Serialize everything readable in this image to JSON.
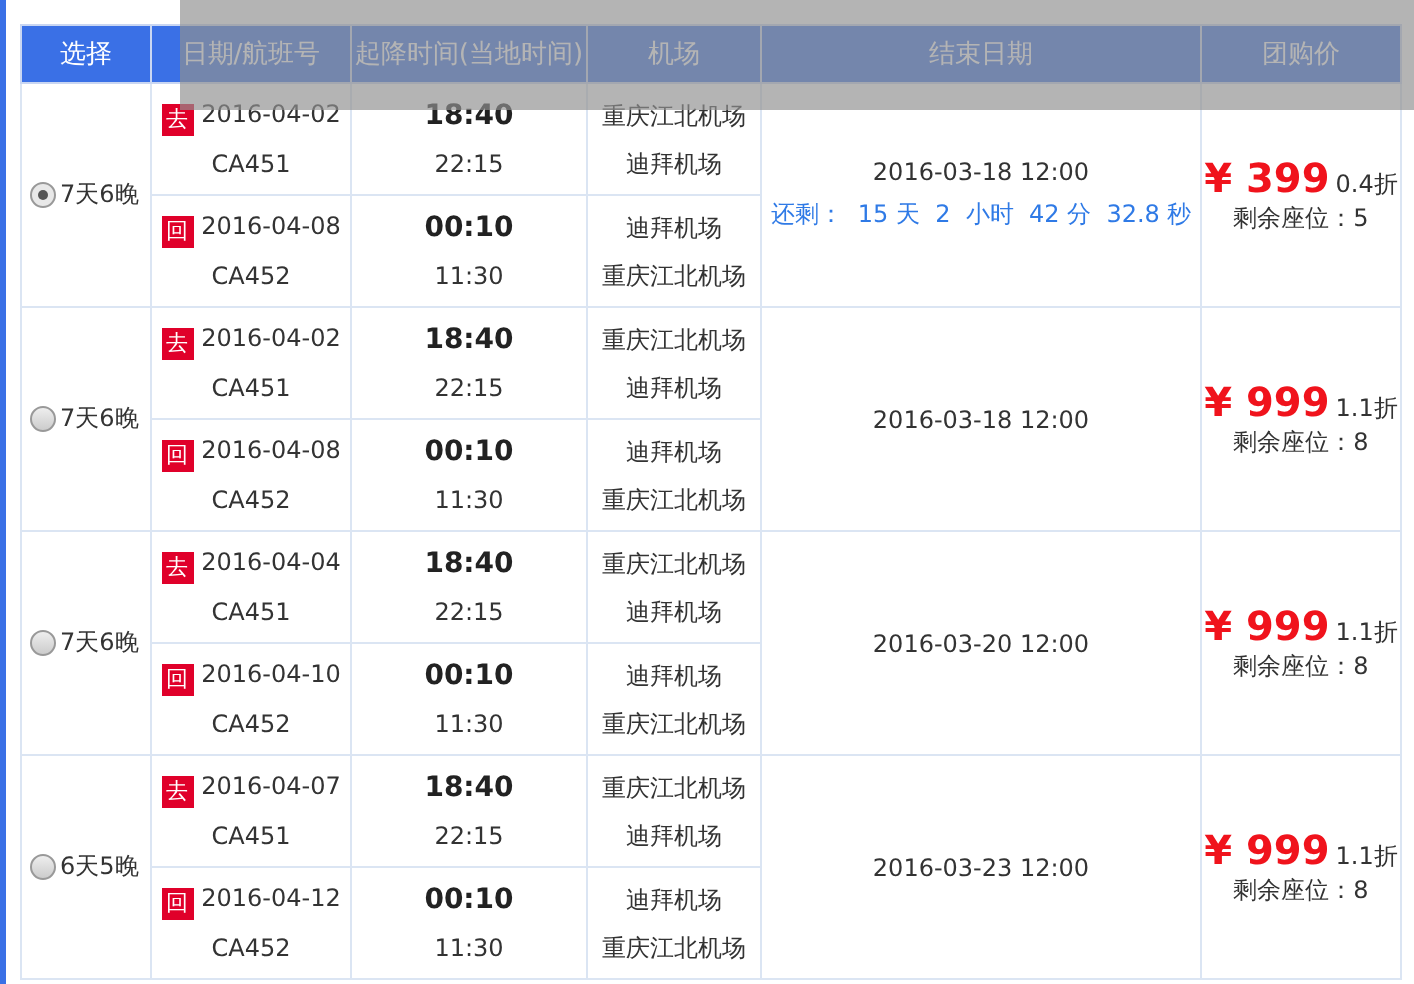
{
  "table": {
    "columns": [
      "选择",
      "日期/航班号",
      "起降时间(当地时间)",
      "机场",
      "结束日期",
      "团购价"
    ],
    "rows": [
      {
        "duration": "7天6晚",
        "selected": true,
        "legs": [
          {
            "direction": "去",
            "date": "2016-04-02",
            "flight": "CA451",
            "depart": "18:40",
            "arrive": "22:15",
            "airports": [
              "重庆江北机场",
              "迪拜机场"
            ]
          },
          {
            "direction": "回",
            "date": "2016-04-08",
            "flight": "CA452",
            "depart": "00:10",
            "arrive": "11:30",
            "airports": [
              "迪拜机场",
              "重庆江北机场"
            ]
          }
        ],
        "end_date": "2016-03-18 12:00",
        "countdown": "还剩：  15 天  2  小时  42 分  32.8 秒",
        "price": "¥ 399",
        "discount": "0.4折",
        "seats": "剩余座位：5"
      },
      {
        "duration": "7天6晚",
        "selected": false,
        "legs": [
          {
            "direction": "去",
            "date": "2016-04-02",
            "flight": "CA451",
            "depart": "18:40",
            "arrive": "22:15",
            "airports": [
              "重庆江北机场",
              "迪拜机场"
            ]
          },
          {
            "direction": "回",
            "date": "2016-04-08",
            "flight": "CA452",
            "depart": "00:10",
            "arrive": "11:30",
            "airports": [
              "迪拜机场",
              "重庆江北机场"
            ]
          }
        ],
        "end_date": "2016-03-18 12:00",
        "price": "¥ 999",
        "discount": "1.1折",
        "seats": "剩余座位：8"
      },
      {
        "duration": "7天6晚",
        "selected": false,
        "legs": [
          {
            "direction": "去",
            "date": "2016-04-04",
            "flight": "CA451",
            "depart": "18:40",
            "arrive": "22:15",
            "airports": [
              "重庆江北机场",
              "迪拜机场"
            ]
          },
          {
            "direction": "回",
            "date": "2016-04-10",
            "flight": "CA452",
            "depart": "00:10",
            "arrive": "11:30",
            "airports": [
              "迪拜机场",
              "重庆江北机场"
            ]
          }
        ],
        "end_date": "2016-03-20 12:00",
        "price": "¥ 999",
        "discount": "1.1折",
        "seats": "剩余座位：8"
      },
      {
        "duration": "6天5晚",
        "selected": false,
        "legs": [
          {
            "direction": "去",
            "date": "2016-04-07",
            "flight": "CA451",
            "depart": "18:40",
            "arrive": "22:15",
            "airports": [
              "重庆江北机场",
              "迪拜机场"
            ]
          },
          {
            "direction": "回",
            "date": "2016-04-12",
            "flight": "CA452",
            "depart": "00:10",
            "arrive": "11:30",
            "airports": [
              "迪拜机场",
              "重庆江北机场"
            ]
          }
        ],
        "end_date": "2016-03-23 12:00",
        "price": "¥ 999",
        "discount": "1.1折",
        "seats": "剩余座位：8"
      }
    ]
  }
}
